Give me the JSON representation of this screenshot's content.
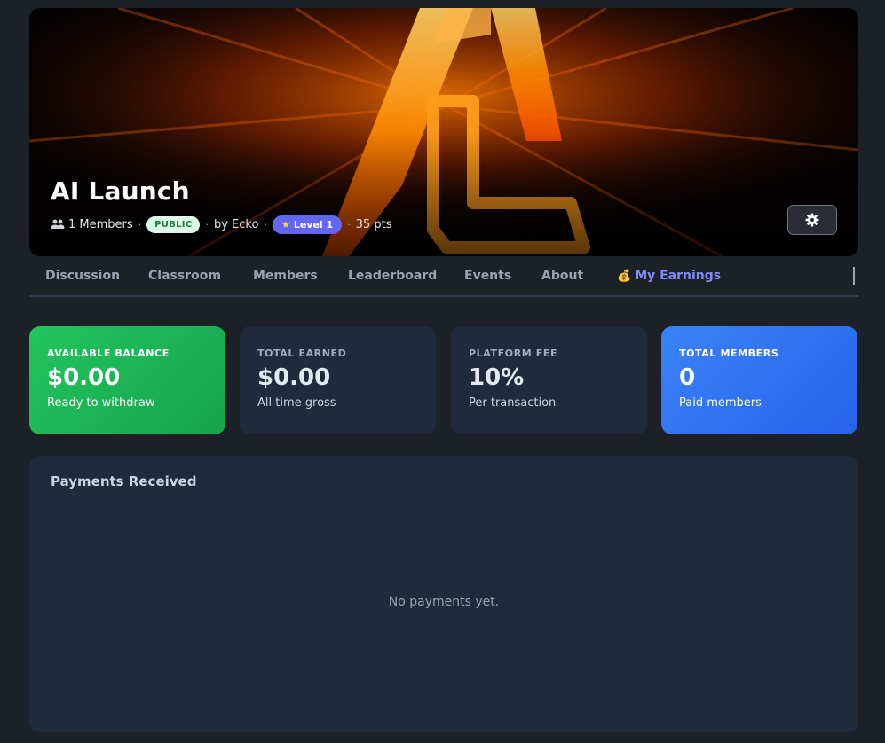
{
  "community": {
    "title": "AI Launch",
    "members_count": "1 Members",
    "visibility_badge": "PUBLIC",
    "author": "by Ecko",
    "level_badge": "Level 1",
    "points": "35 pts"
  },
  "tabs": [
    {
      "label": "Discussion"
    },
    {
      "label": "Classroom"
    },
    {
      "label": "Members"
    },
    {
      "label": "Leaderboard"
    },
    {
      "label": "Events"
    },
    {
      "label": "About"
    },
    {
      "label": "My Earnings",
      "active": true
    }
  ],
  "stats": {
    "available_balance": {
      "label": "AVAILABLE BALANCE",
      "value": "$0.00",
      "sub": "Ready to withdraw"
    },
    "total_earned": {
      "label": "TOTAL EARNED",
      "value": "$0.00",
      "sub": "All time gross"
    },
    "platform_fee": {
      "label": "PLATFORM FEE",
      "value": "10%",
      "sub": "Per transaction"
    },
    "total_members": {
      "label": "TOTAL MEMBERS",
      "value": "0",
      "sub": "Paid members"
    }
  },
  "payments": {
    "title": "Payments Received",
    "empty_text": "No payments yet."
  },
  "icons": {
    "members": "users-icon",
    "level": "star-icon",
    "settings": "gear-icon",
    "earnings": "money-bag-icon"
  },
  "colors": {
    "accent": "#818cf8",
    "green_card": "#22c55e",
    "blue_card": "#3b82f6",
    "level_badge": "#6366f1",
    "public_badge_bg": "#dcfce7",
    "public_badge_text": "#15803d"
  }
}
